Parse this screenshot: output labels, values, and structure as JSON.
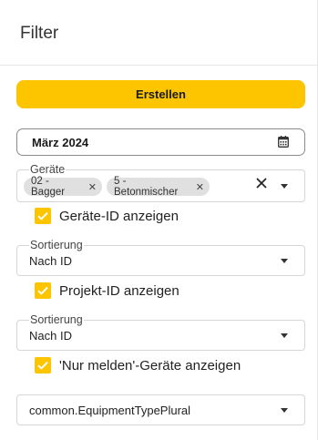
{
  "header": {
    "title": "Filter"
  },
  "create_button": {
    "label": "Erstellen"
  },
  "date_field": {
    "value": "März 2024",
    "icon": "calendar-icon"
  },
  "devices": {
    "label": "Geräte",
    "chips": [
      {
        "label": "02 - Bagger"
      },
      {
        "label": "5 - Betonmischer"
      }
    ],
    "chip_remove_glyph": "✕"
  },
  "checkboxes": [
    {
      "label": "Geräte-ID anzeigen",
      "checked": true
    },
    {
      "label": "Projekt-ID anzeigen",
      "checked": true
    },
    {
      "label": "'Nur melden'-Geräte anzeigen",
      "checked": true
    }
  ],
  "sort_1": {
    "label": "Sortierung",
    "value": "Nach ID"
  },
  "sort_2": {
    "label": "Sortierung",
    "value": "Nach ID"
  },
  "equipment_type": {
    "value": "common.EquipmentTypePlural"
  },
  "colors": {
    "accent": "#fdc500",
    "border": "#d6d6d6"
  }
}
